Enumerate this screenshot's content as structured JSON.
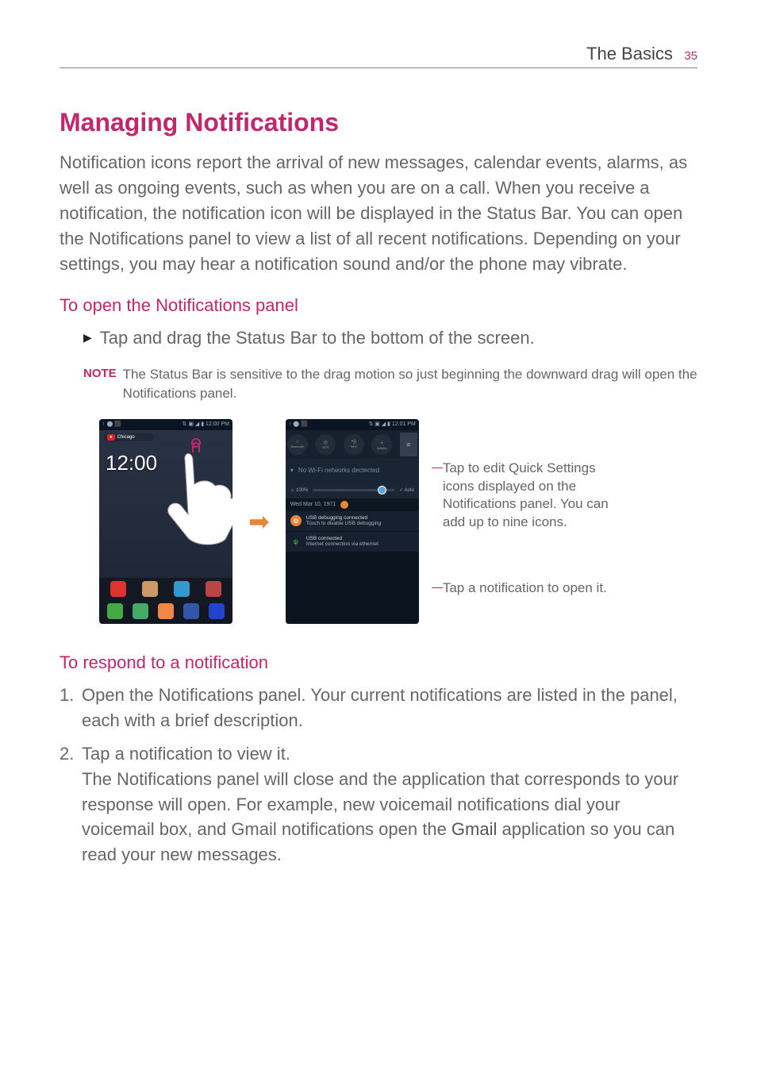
{
  "header": {
    "chapter": "The Basics",
    "page": "35"
  },
  "title": "Managing Notifications",
  "intro": "Notification icons report the arrival of new messages, calendar events, alarms, as well as ongoing events, such as when you are on a call. When you receive a notification, the notification icon will be displayed in the Status Bar. You can open the Notifications panel to view a list of all recent notifications. Depending on your settings, you may hear a notification sound and/or the phone may vibrate.",
  "section_open": {
    "heading": "To open the Notifications panel",
    "bullet": "Tap and drag the Status Bar to the bottom of the screen.",
    "note_label": "NOTE",
    "note_text": "The Status Bar is sensitive to the drag motion so just beginning the downward drag will open the Notifications panel."
  },
  "figure": {
    "home": {
      "weather_label": "Chicago",
      "clock": "12:00",
      "status_left": "↑ ⬤ ⬛",
      "status_right": "⇅ ▣ ◢ ▮ 12:00 PM"
    },
    "notif": {
      "status_left": "↑ ⬤ ⬛",
      "status_right": "⇅ ▣ ◢ ▮ 12:01 PM",
      "qs": [
        {
          "label": "Bluetooth",
          "sym": "○"
        },
        {
          "label": "GPS",
          "sym": "◎"
        },
        {
          "label": "NFC",
          "sym": "•))"
        },
        {
          "label": "AddItm",
          "sym": "＋"
        }
      ],
      "edit": "≡",
      "wifi_text": "No Wi-Fi networks dectected",
      "brightness_left": "☼ 100%",
      "brightness_right": "✓ Auto",
      "date": "Wed Mar 10, 1971",
      "items": [
        {
          "title": "USB debugging connected",
          "sub": "Touch to disable USB debugging"
        },
        {
          "title": "USB connected",
          "sub": "Internet connection via ethernet"
        }
      ]
    },
    "callouts": {
      "quick_settings": "Tap to edit Quick Settings icons displayed on the Notifications panel. You can add up to nine icons.",
      "open_notification": "Tap a notification to open it."
    }
  },
  "section_respond": {
    "heading": "To respond to a notification",
    "steps": [
      {
        "num": "1.",
        "text": "Open the Notifications panel. Your current notifications are listed in the panel, each with a brief description."
      },
      {
        "num": "2.",
        "lead": "Tap a notification to view it.",
        "text": "The Notifications panel will close and the application that corresponds to your response will open. For example, new voicemail notifications dial your voicemail box, and Gmail notifications open the ",
        "app": "Gmail",
        "text_tail": " application so you can read your new messages."
      }
    ]
  }
}
